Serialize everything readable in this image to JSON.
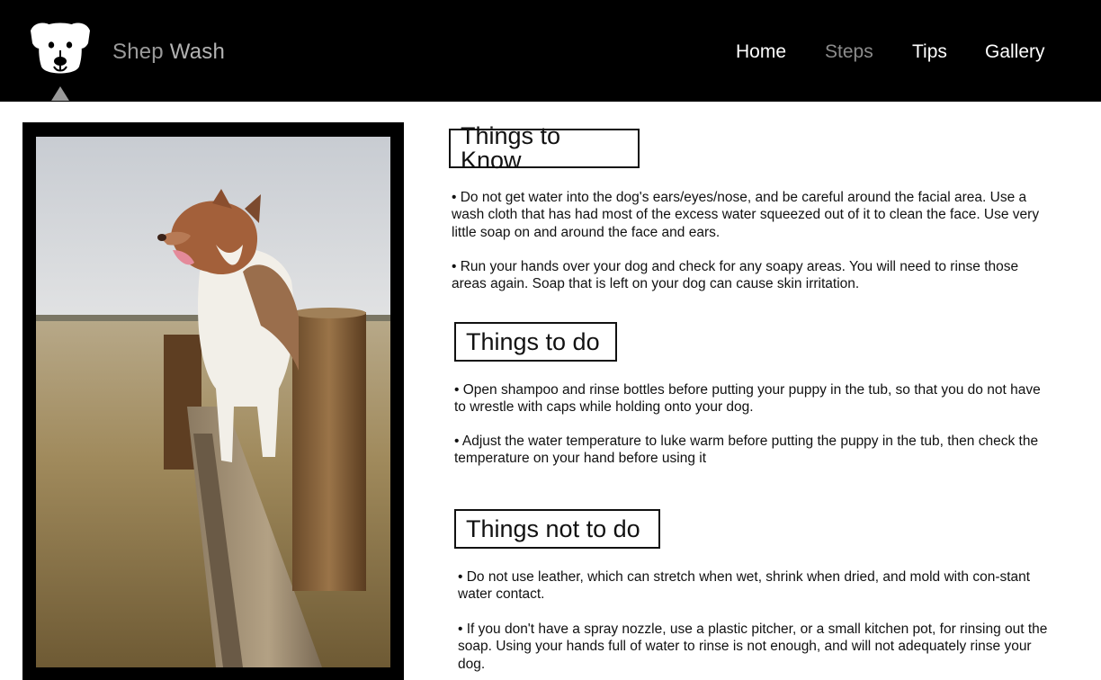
{
  "brand": {
    "word1": "Shep",
    "word2": "Wash"
  },
  "nav": {
    "items": [
      "Home",
      "Steps",
      "Tips",
      "Gallery"
    ],
    "active": "Steps"
  },
  "sections": [
    {
      "heading": "Things to Know",
      "paragraphs": [
        "• Do not get water into the dog's ears/eyes/nose, and be careful around the facial area. Use a wash cloth that has had most of the excess water squeezed out of it to clean the face. Use very little soap on and around the face and ears.",
        "• Run your hands over your dog and check for any soapy areas. You will need to rinse those areas again. Soap that is left on your dog can cause skin irritation."
      ]
    },
    {
      "heading": "Things to do",
      "paragraphs": [
        "• Open shampoo and rinse bottles before putting your puppy in the tub, so that you do not have to wrestle with caps while holding onto your dog.",
        "• Adjust the water temperature to luke warm before putting the puppy in the tub, then check the temperature on your hand before using it"
      ]
    },
    {
      "heading": "Things not to do",
      "paragraphs": [
        "• Do not use leather, which can stretch when wet, shrink when dried, and mold with con-stant water contact.",
        "• If you don't have a spray nozzle, use a plastic pitcher, or a small kitchen pot, for rinsing out the soap. Using your hands full of water to rinse is not enough, and will not adequately rinse your dog."
      ]
    }
  ],
  "colors": {
    "header_bg": "#000000",
    "nav_text": "#ffffff",
    "nav_active": "#8c8c8c",
    "brand_text": "#9a9a9a"
  },
  "icons": {
    "logo": "dog-face-icon",
    "active_marker": "triangle-up-icon"
  },
  "image": {
    "subject": "australian-shepherd-on-fence-photo"
  }
}
